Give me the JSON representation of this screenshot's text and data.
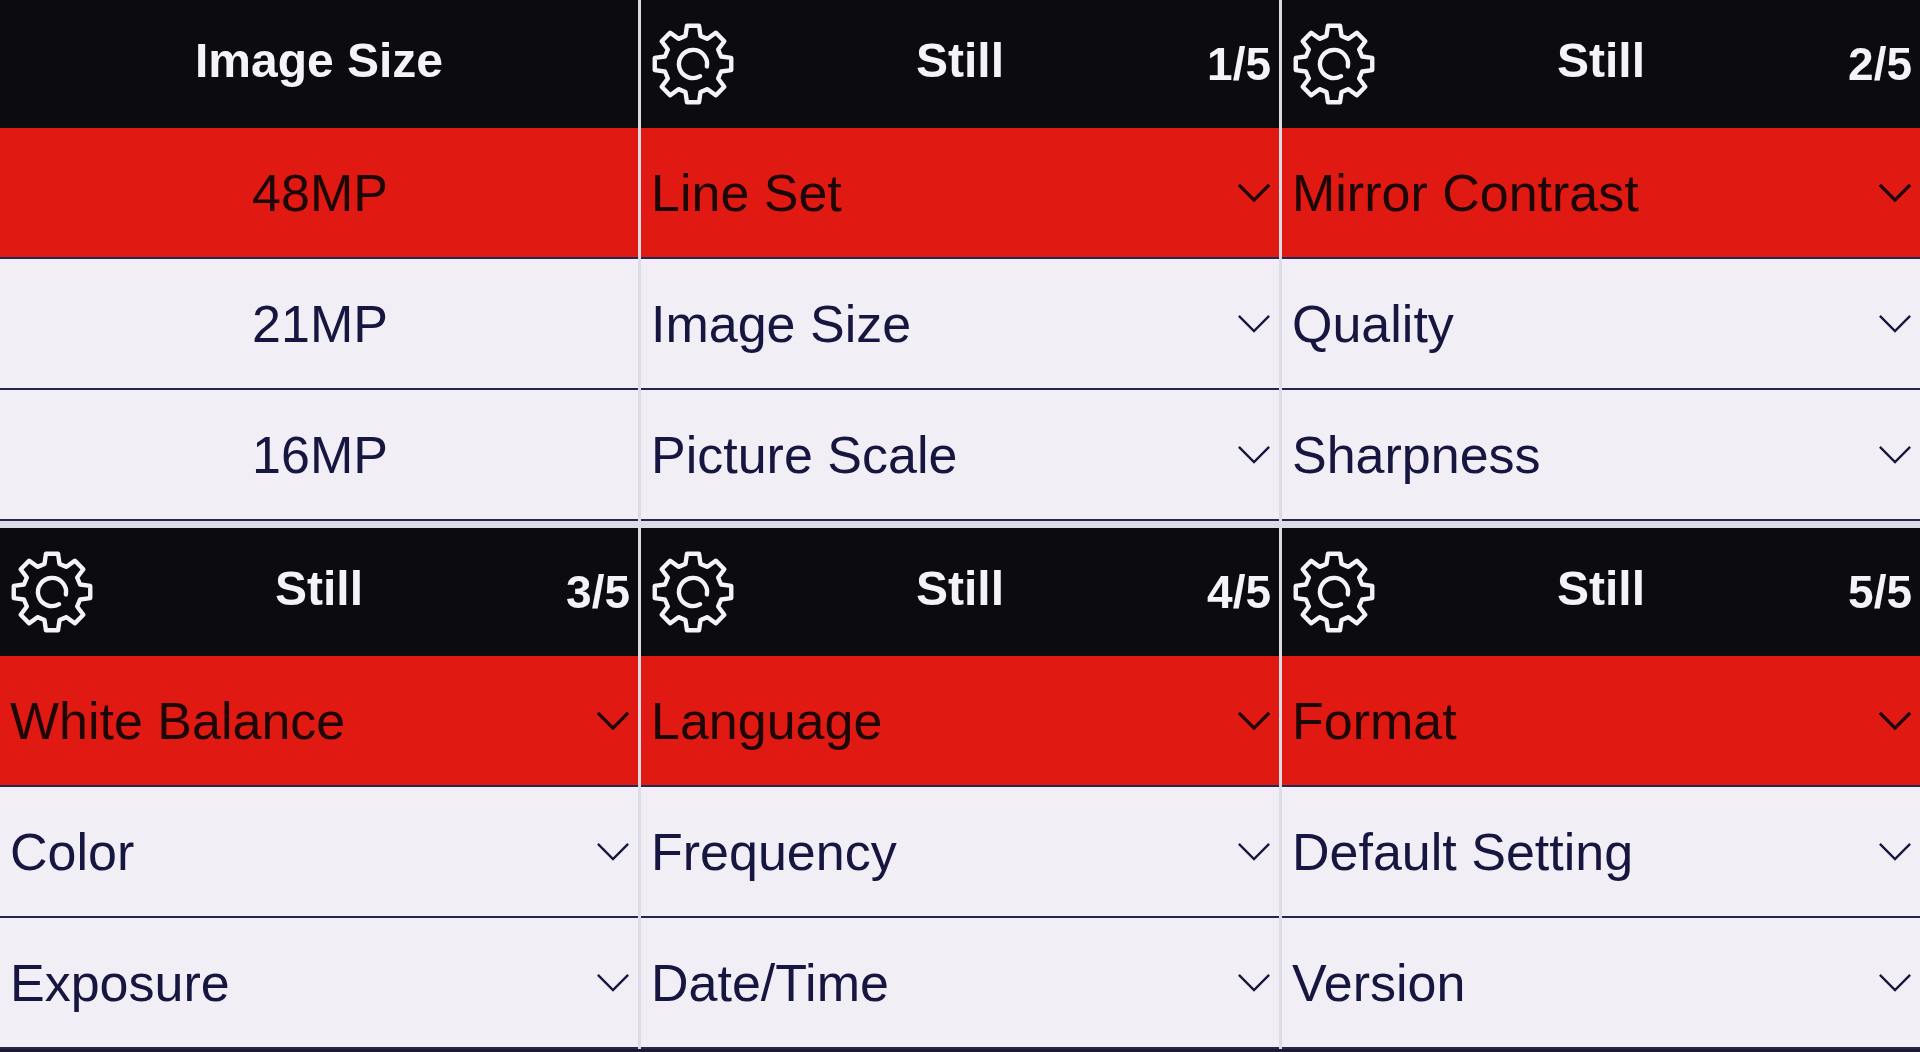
{
  "panels": [
    {
      "kind": "options",
      "title": "Image Size",
      "items": [
        {
          "label": "48MP",
          "selected": true
        },
        {
          "label": "21MP",
          "selected": false
        },
        {
          "label": "16MP",
          "selected": false
        }
      ]
    },
    {
      "kind": "settings",
      "title": "Still",
      "page": "1/5",
      "items": [
        {
          "label": "Line Set",
          "selected": true
        },
        {
          "label": "Image Size",
          "selected": false
        },
        {
          "label": "Picture Scale",
          "selected": false
        }
      ]
    },
    {
      "kind": "settings",
      "title": "Still",
      "page": "2/5",
      "items": [
        {
          "label": "Mirror Contrast",
          "selected": true
        },
        {
          "label": "Quality",
          "selected": false
        },
        {
          "label": "Sharpness",
          "selected": false
        }
      ]
    },
    {
      "kind": "settings",
      "title": "Still",
      "page": "3/5",
      "items": [
        {
          "label": "White Balance",
          "selected": true
        },
        {
          "label": "Color",
          "selected": false
        },
        {
          "label": "Exposure",
          "selected": false
        }
      ]
    },
    {
      "kind": "settings",
      "title": "Still",
      "page": "4/5",
      "items": [
        {
          "label": "Language",
          "selected": true
        },
        {
          "label": "Frequency",
          "selected": false
        },
        {
          "label": "Date/Time",
          "selected": false
        }
      ]
    },
    {
      "kind": "settings",
      "title": "Still",
      "page": "5/5",
      "items": [
        {
          "label": "Format",
          "selected": true
        },
        {
          "label": "Default Setting",
          "selected": false
        },
        {
          "label": "Version",
          "selected": false
        }
      ]
    }
  ]
}
